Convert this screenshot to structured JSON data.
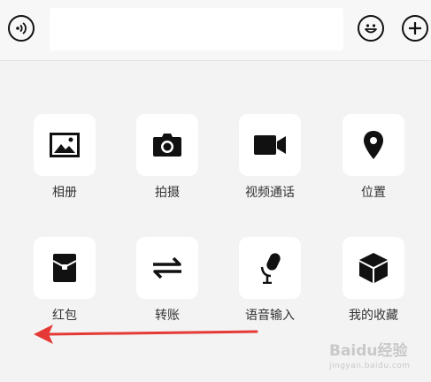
{
  "input_bar": {
    "voice_icon": "voice-wave-icon",
    "text_value": "",
    "emoji_icon": "smiley-face-icon",
    "more_icon": "plus-icon"
  },
  "actions": [
    {
      "label": "相册",
      "icon": "image-icon"
    },
    {
      "label": "拍摄",
      "icon": "camera-icon"
    },
    {
      "label": "视频通话",
      "icon": "video-camera-icon"
    },
    {
      "label": "位置",
      "icon": "location-pin-icon"
    },
    {
      "label": "红包",
      "icon": "red-packet-icon"
    },
    {
      "label": "转账",
      "icon": "transfer-arrows-icon"
    },
    {
      "label": "语音输入",
      "icon": "microphone-icon"
    },
    {
      "label": "我的收藏",
      "icon": "cube-icon"
    }
  ],
  "annotation": {
    "arrow_color": "#e53935"
  },
  "watermark": {
    "brand": "Baidu经验",
    "url": "jingyan.baidu.com"
  },
  "colors": {
    "icon": "#111111",
    "tile": "#ffffff",
    "background": "#f3f3f3",
    "label": "#333333"
  }
}
